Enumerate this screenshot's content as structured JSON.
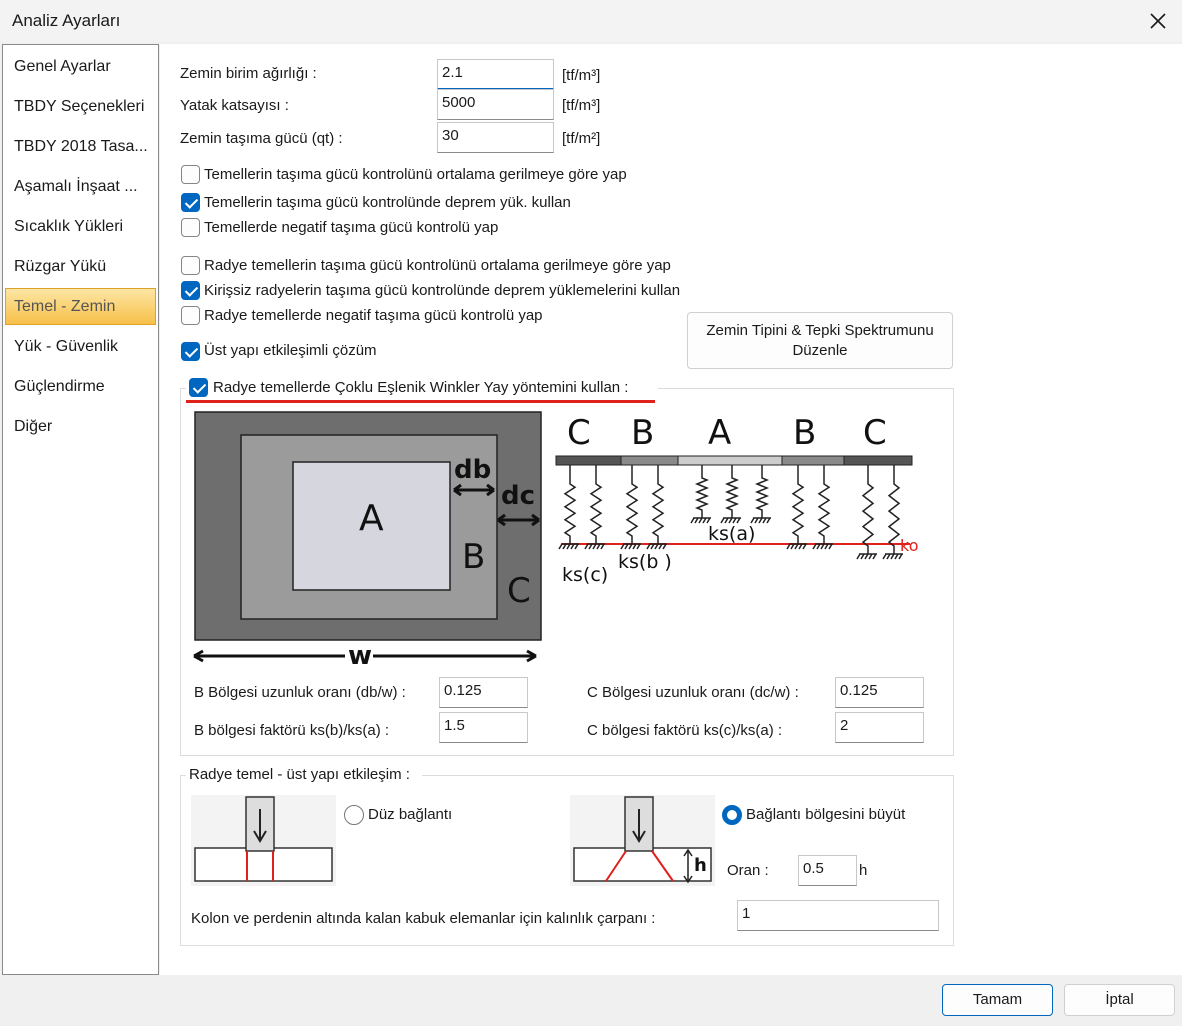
{
  "window": {
    "title": "Analiz Ayarları"
  },
  "sidebar": {
    "items": [
      {
        "label": "Genel Ayarlar"
      },
      {
        "label": "TBDY Seçenekleri"
      },
      {
        "label": "TBDY 2018 Tasa..."
      },
      {
        "label": "Aşamalı İnşaat ..."
      },
      {
        "label": "Sıcaklık Yükleri"
      },
      {
        "label": "Rüzgar Yükü"
      },
      {
        "label": "Temel - Zemin",
        "active": true
      },
      {
        "label": "Yük - Güvenlik"
      },
      {
        "label": "Güçlendirme"
      },
      {
        "label": "Diğer"
      }
    ]
  },
  "soil": {
    "unit_weight_label": "Zemin birim ağırlığı :",
    "unit_weight_value": "2.1",
    "unit_weight_unit": "[tf/m³]",
    "bed_coef_label": "Yatak katsayısı :",
    "bed_coef_value": "5000",
    "bed_coef_unit": "[tf/m³]",
    "bearing_label": "Zemin taşıma gücü (qt) :",
    "bearing_value": "30",
    "bearing_unit": "[tf/m²]"
  },
  "checks": {
    "c1": {
      "label": "Temellerin taşıma gücü kontrolünü ortalama gerilmeye göre yap",
      "checked": false
    },
    "c2": {
      "label": "Temellerin taşıma gücü kontrolünde deprem yük. kullan",
      "checked": true
    },
    "c3": {
      "label": "Temellerde negatif taşıma gücü kontrolü yap",
      "checked": false
    },
    "c4": {
      "label": "Radye temellerin taşıma gücü kontrolünü ortalama gerilmeye göre yap",
      "checked": false
    },
    "c5": {
      "label": "Kirişsiz radyelerin taşıma gücü kontrolünde deprem yüklemelerini kullan",
      "checked": true
    },
    "c6": {
      "label": "Radye temellerde negatif taşıma gücü kontrolü yap",
      "checked": false
    },
    "c7": {
      "label": "Üst yapı etkileşimli çözüm",
      "checked": true
    }
  },
  "spectrum_button": {
    "line1": "Zemin Tipini  & Tepki Spektrumunu",
    "line2": "Düzenle"
  },
  "winkler": {
    "label": "Radye temellerde Çoklu Eşlenik Winkler Yay yöntemini kullan :",
    "checked": true,
    "diagram": {
      "A": "A",
      "B": "B",
      "C": "C",
      "db": "db",
      "dc": "dc",
      "w": "w",
      "ks_a": "ks(a)",
      "ks_b": "ks(b )",
      "ks_c": "ks(c)",
      "ko": "ko"
    },
    "b_len_label": "B Bölgesi uzunluk oranı (db/w) :",
    "b_len_value": "0.125",
    "b_fac_label": "B bölgesi faktörü ks(b)/ks(a) :",
    "b_fac_value": "1.5",
    "c_len_label": "C Bölgesi uzunluk oranı (dc/w) :",
    "c_len_value": "0.125",
    "c_fac_label": "C bölgesi faktörü ks(c)/ks(a) :",
    "c_fac_value": "2"
  },
  "interaction": {
    "title": "Radye temel - üst yapı etkileşim :",
    "flat_label": "Düz bağlantı",
    "flat_selected": false,
    "grow_label": "Bağlantı bölgesini büyüt",
    "grow_selected": true,
    "h_label": "h",
    "ratio_label": "Oran :",
    "ratio_value": "0.5",
    "ratio_unit": "h",
    "thickness_label": "Kolon ve perdenin altında kalan kabuk elemanlar için kalınlık çarpanı :",
    "thickness_value": "1"
  },
  "footer": {
    "ok": "Tamam",
    "cancel": "İptal"
  },
  "colors": {
    "accent": "#0067c0",
    "highlight_red": "#e0201b",
    "sidebar_active": "#f7c04a"
  }
}
